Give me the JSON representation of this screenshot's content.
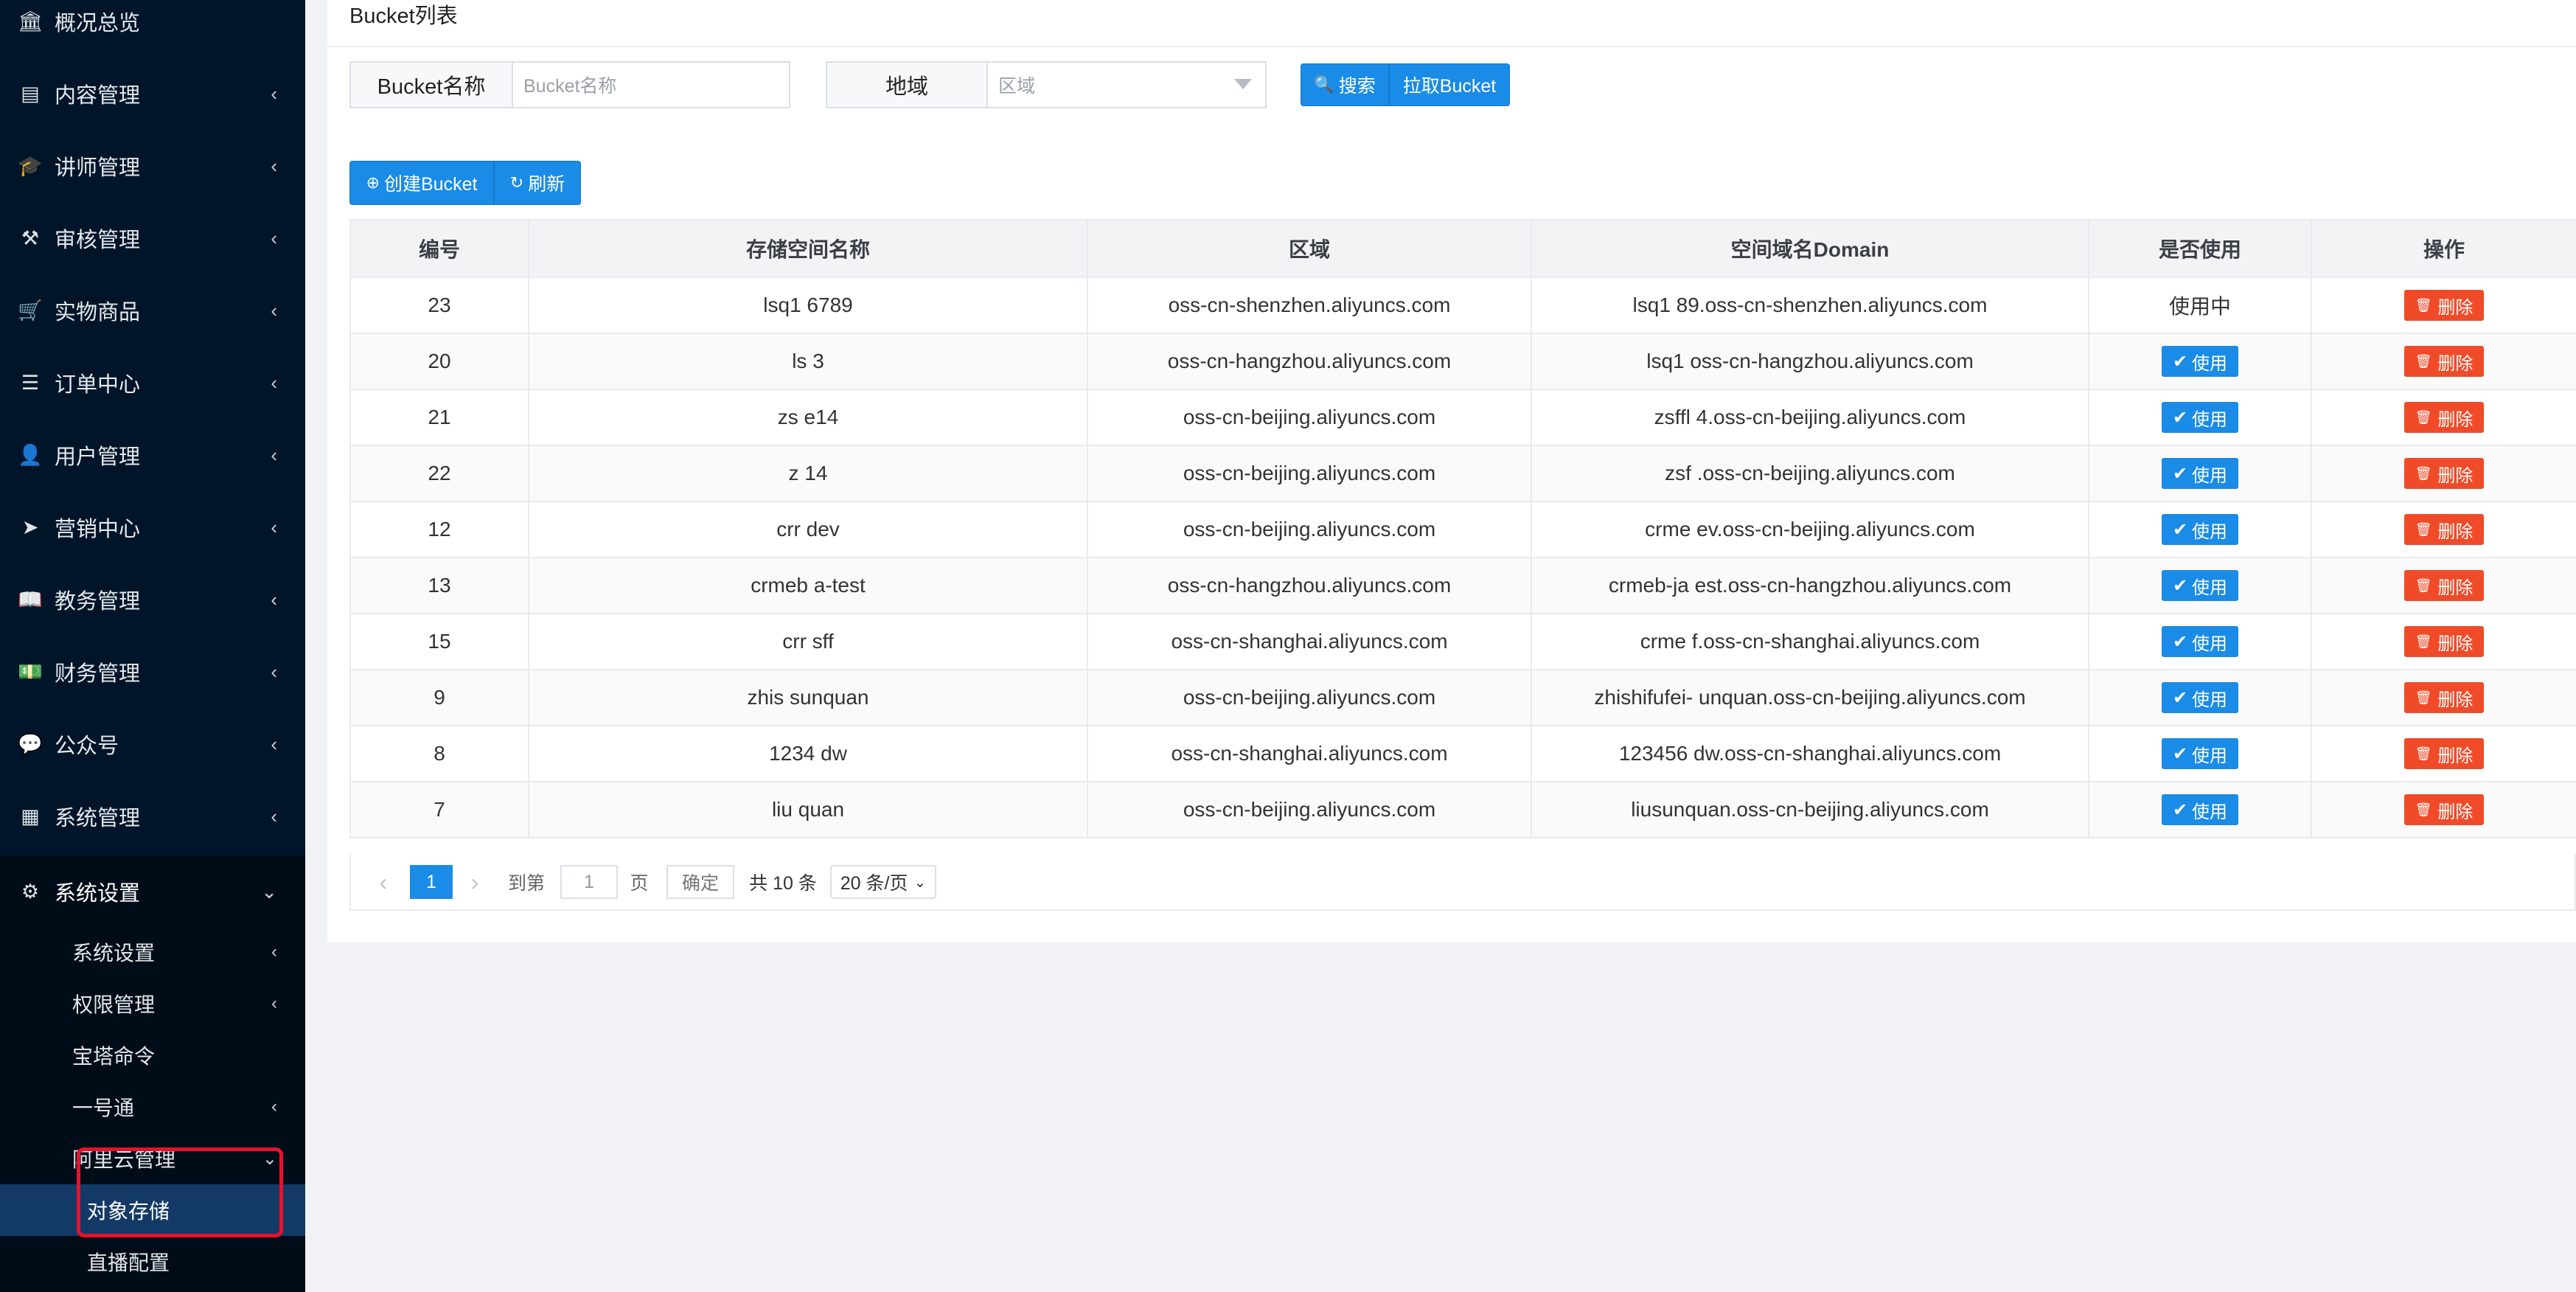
{
  "sidebar": {
    "items": [
      {
        "label": "概况总览",
        "icon": "bank-icon",
        "glyph": "🏛",
        "chev": ""
      },
      {
        "label": "内容管理",
        "icon": "newspaper-icon",
        "glyph": "▤",
        "chev": "‹"
      },
      {
        "label": "讲师管理",
        "icon": "graduation-cap-icon",
        "glyph": "🎓",
        "chev": "‹"
      },
      {
        "label": "审核管理",
        "icon": "gavel-icon",
        "glyph": "⚒",
        "chev": "‹"
      },
      {
        "label": "实物商品",
        "icon": "cart-icon",
        "glyph": "🛒",
        "chev": "‹"
      },
      {
        "label": "订单中心",
        "icon": "list-icon",
        "glyph": "☰",
        "chev": "‹"
      },
      {
        "label": "用户管理",
        "icon": "user-icon",
        "glyph": "👤",
        "chev": "‹"
      },
      {
        "label": "营销中心",
        "icon": "paper-plane-icon",
        "glyph": "➤",
        "chev": "‹"
      },
      {
        "label": "教务管理",
        "icon": "book-icon",
        "glyph": "📖",
        "chev": "‹"
      },
      {
        "label": "财务管理",
        "icon": "money-icon",
        "glyph": "💵",
        "chev": "‹"
      },
      {
        "label": "公众号",
        "icon": "wechat-icon",
        "glyph": "💬",
        "chev": "‹"
      },
      {
        "label": "系统管理",
        "icon": "grid-icon",
        "glyph": "▦",
        "chev": "‹"
      },
      {
        "label": "系统设置",
        "icon": "gear-icon",
        "glyph": "⚙",
        "chev": "⌄"
      }
    ],
    "sub_items": [
      {
        "label": "系统设置",
        "chev": "‹"
      },
      {
        "label": "权限管理",
        "chev": "‹"
      },
      {
        "label": "宝塔命令",
        "chev": ""
      },
      {
        "label": "一号通",
        "chev": "‹"
      },
      {
        "label": "阿里云管理",
        "chev": "⌄"
      }
    ],
    "third_items": [
      {
        "label": "对象存储"
      },
      {
        "label": "直播配置"
      }
    ]
  },
  "main": {
    "title": "Bucket列表",
    "filters": {
      "name_label": "Bucket名称",
      "name_placeholder": "Bucket名称",
      "region_label": "地域",
      "region_placeholder": "区域"
    },
    "buttons": {
      "search": "搜索",
      "pull": "拉取Bucket",
      "create": "创建Bucket",
      "refresh": "刷新"
    },
    "table": {
      "headers": [
        "编号",
        "存储空间名称",
        "区域",
        "空间域名Domain",
        "是否使用",
        "操作"
      ],
      "rows": [
        {
          "id": "23",
          "name": "lsq1  6789",
          "region": "oss-cn-shenzhen.aliyuncs.com",
          "domain": "lsq1      89.oss-cn-shenzhen.aliyuncs.com",
          "in_use": true
        },
        {
          "id": "20",
          "name": "ls   3",
          "region": "oss-cn-hangzhou.aliyuncs.com",
          "domain": "lsq1    oss-cn-hangzhou.aliyuncs.com",
          "in_use": false
        },
        {
          "id": "21",
          "name": "zs   e14",
          "region": "oss-cn-beijing.aliyuncs.com",
          "domain": "zsffl    4.oss-cn-beijing.aliyuncs.com",
          "in_use": false
        },
        {
          "id": "22",
          "name": "z   14",
          "region": "oss-cn-beijing.aliyuncs.com",
          "domain": "zsf    .oss-cn-beijing.aliyuncs.com",
          "in_use": false
        },
        {
          "id": "12",
          "name": "crr   dev",
          "region": "oss-cn-beijing.aliyuncs.com",
          "domain": "crme    ev.oss-cn-beijing.aliyuncs.com",
          "in_use": false
        },
        {
          "id": "13",
          "name": "crmeb   a-test",
          "region": "oss-cn-hangzhou.aliyuncs.com",
          "domain": "crmeb-ja   est.oss-cn-hangzhou.aliyuncs.com",
          "in_use": false
        },
        {
          "id": "15",
          "name": "crr   sff",
          "region": "oss-cn-shanghai.aliyuncs.com",
          "domain": "crme    f.oss-cn-shanghai.aliyuncs.com",
          "in_use": false
        },
        {
          "id": "9",
          "name": "zhis      sunquan",
          "region": "oss-cn-beijing.aliyuncs.com",
          "domain": "zhishifufei-   unquan.oss-cn-beijing.aliyuncs.com",
          "in_use": false
        },
        {
          "id": "8",
          "name": "1234   dw",
          "region": "oss-cn-shanghai.aliyuncs.com",
          "domain": "123456   dw.oss-cn-shanghai.aliyuncs.com",
          "in_use": false
        },
        {
          "id": "7",
          "name": "liu   quan",
          "region": "oss-cn-beijing.aliyuncs.com",
          "domain": "liusunquan.oss-cn-beijing.aliyuncs.com",
          "in_use": false
        }
      ],
      "in_use_text": "使用中",
      "use_label": "使用",
      "delete_label": "删除"
    },
    "pagination": {
      "current_page": "1",
      "goto_label": "到第",
      "goto_value": "1",
      "page_unit": "页",
      "confirm": "确定",
      "total": "共 10 条",
      "page_size": "20 条/页"
    }
  },
  "colors": {
    "sidebar_bg": "#001529",
    "primary": "#1a8be6",
    "danger": "#f04b28",
    "highlight_box": "#e8112d"
  }
}
